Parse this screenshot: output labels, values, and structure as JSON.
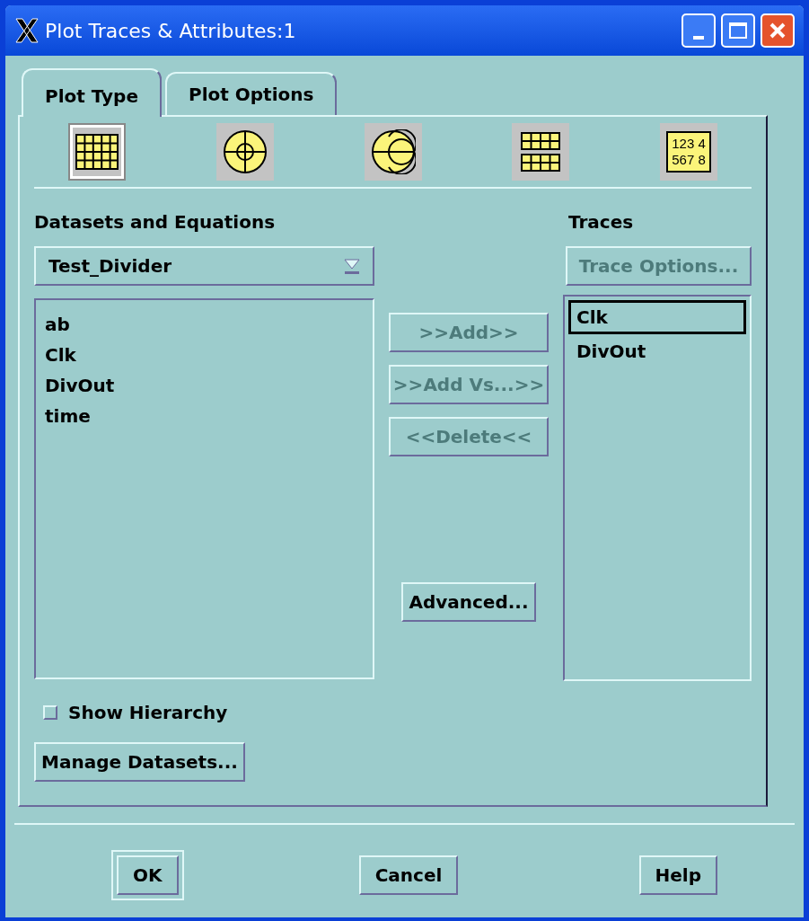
{
  "window": {
    "title": "Plot Traces & Attributes:1"
  },
  "tabs": [
    {
      "label": "Plot Type",
      "selected": true
    },
    {
      "label": "Plot Options",
      "selected": false
    }
  ],
  "plot_types": [
    {
      "kind": "rectangular",
      "selected": true
    },
    {
      "kind": "polar",
      "selected": false
    },
    {
      "kind": "smith",
      "selected": false
    },
    {
      "kind": "stacked",
      "selected": false
    },
    {
      "kind": "list",
      "selected": false,
      "lines": [
        "123 4",
        "567 8"
      ]
    }
  ],
  "datasets": {
    "label": "Datasets and Equations",
    "dropdown": "Test_Divider",
    "items": [
      "ab",
      "Clk",
      "DivOut",
      "time"
    ]
  },
  "actions": [
    {
      "label": ">>Add>>",
      "disabled": true
    },
    {
      "label": ">>Add Vs...>>",
      "disabled": true
    },
    {
      "label": "<<Delete<<",
      "disabled": true
    }
  ],
  "advanced": {
    "label": "Advanced...",
    "disabled": false
  },
  "traces": {
    "label": "Traces",
    "options_button": {
      "label": "Trace Options...",
      "disabled": true
    },
    "items": [
      {
        "label": "Clk",
        "selected": true
      },
      {
        "label": "DivOut",
        "selected": false
      }
    ]
  },
  "show_hierarchy": {
    "label": "Show Hierarchy",
    "checked": false
  },
  "manage_button": "Manage Datasets...",
  "buttons": [
    {
      "label": "OK",
      "default": true
    },
    {
      "label": "Cancel",
      "default": false
    },
    {
      "label": "Help",
      "default": false
    }
  ]
}
